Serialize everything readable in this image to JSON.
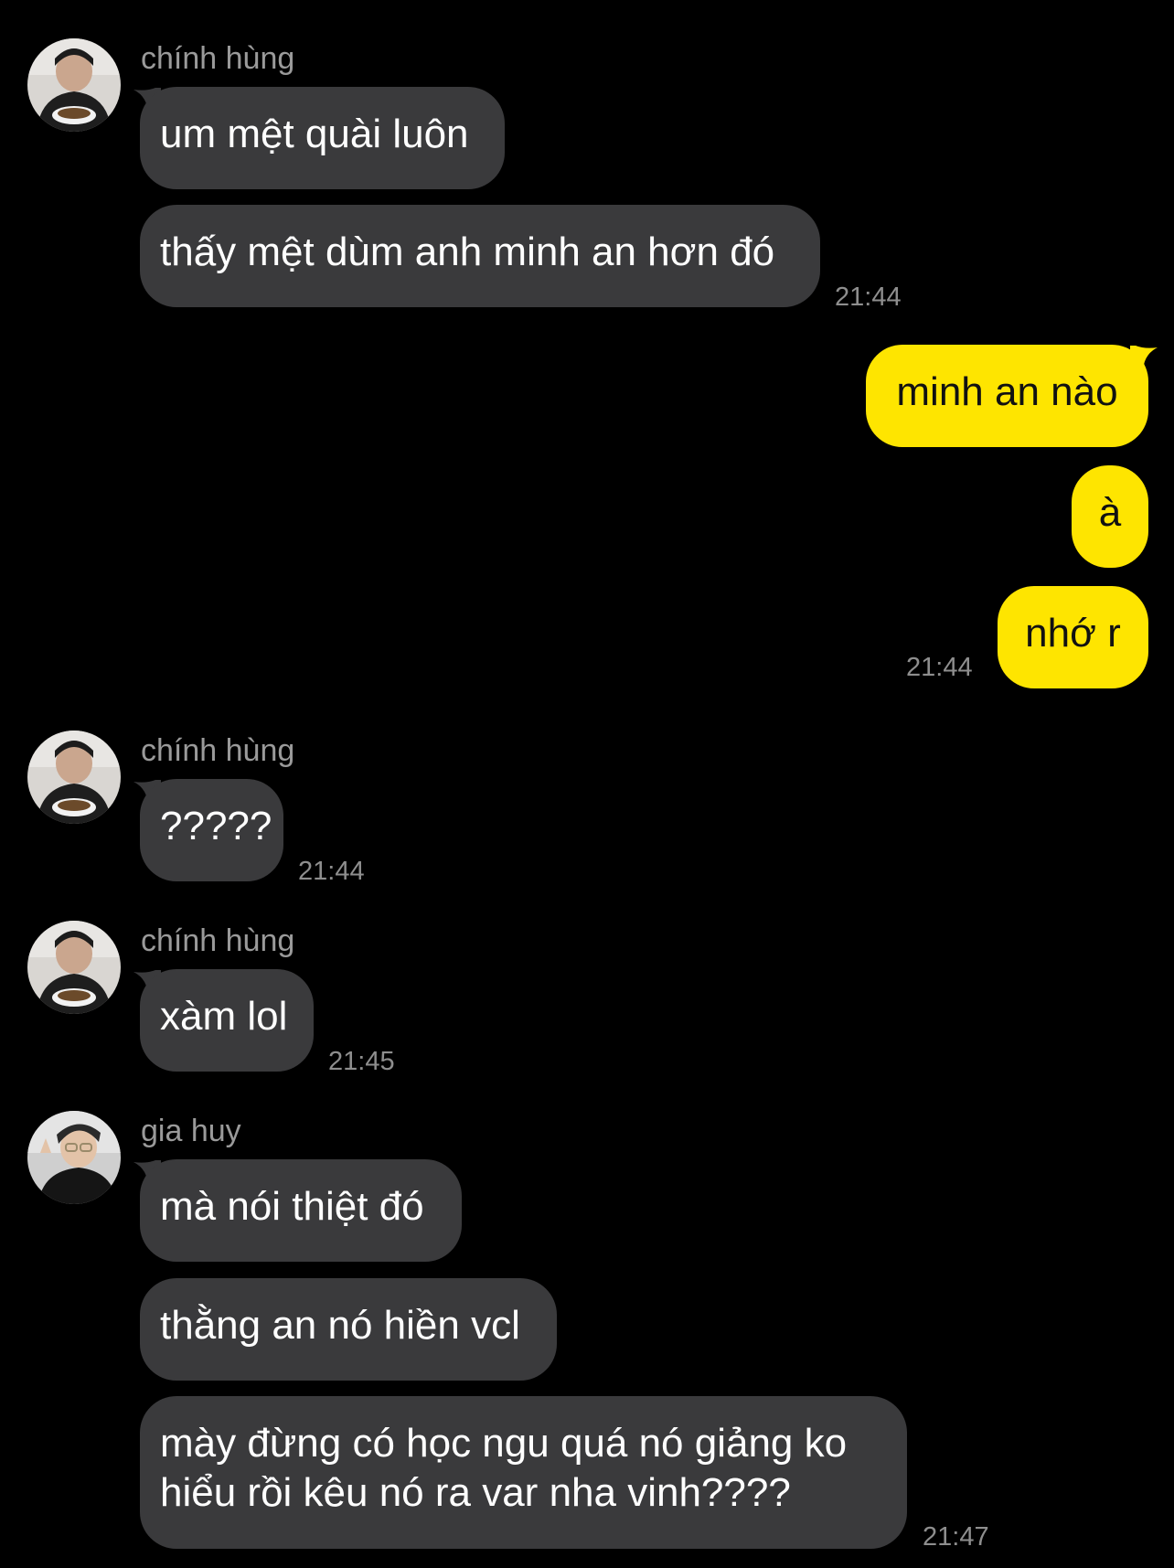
{
  "colors": {
    "background": "#000000",
    "incoming_bubble": "#3a3a3c",
    "outgoing_bubble": "#fee500",
    "sender_name": "#9a9a9a",
    "timestamp": "#8e8e8e"
  },
  "groups": [
    {
      "sender": "chính hùng",
      "avatar_icon": "person-avatar-icon",
      "messages": [
        "um mệt quài luôn",
        "thấy mệt dùm anh minh an hơn đó"
      ],
      "time": "21:44"
    },
    {
      "sender": "",
      "outgoing": true,
      "messages": [
        "minh an nào",
        "à",
        "nhớ r"
      ],
      "time": "21:44"
    },
    {
      "sender": "chính hùng",
      "avatar_icon": "person-avatar-icon",
      "messages": [
        "?????"
      ],
      "time": "21:44"
    },
    {
      "sender": "chính hùng",
      "avatar_icon": "person-avatar-icon",
      "messages": [
        "xàm lol"
      ],
      "time": "21:45"
    },
    {
      "sender": "gia huy",
      "avatar_icon": "person-avatar-icon",
      "messages": [
        "mà nói thiệt đó",
        "thằng an nó hiền vcl",
        "mày đừng có học ngu quá nó giảng ko hiểu rồi kêu nó ra var nha vinh????"
      ],
      "time": "21:47"
    }
  ]
}
